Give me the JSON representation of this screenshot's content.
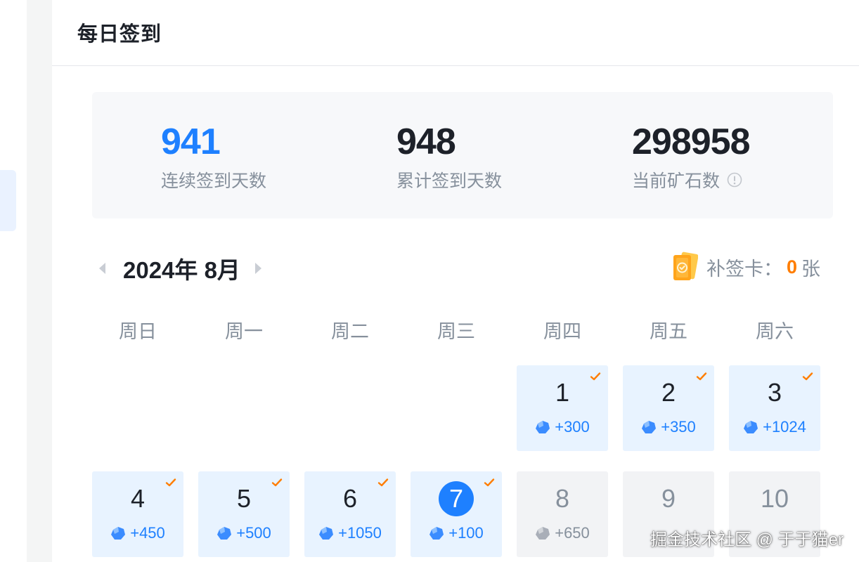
{
  "header": {
    "title": "每日签到"
  },
  "stats": [
    {
      "value": "941",
      "label": "连续签到天数",
      "color": "#1e80ff",
      "info": false
    },
    {
      "value": "948",
      "label": "累计签到天数",
      "color": "#1d2129",
      "info": false
    },
    {
      "value": "298958",
      "label": "当前矿石数",
      "color": "#1d2129",
      "info": true
    }
  ],
  "calendar": {
    "month_label": "2024年 8月",
    "makeup_card": {
      "label": "补签卡：",
      "count": "0",
      "unit": "张"
    },
    "weekdays": [
      "周日",
      "周一",
      "周二",
      "周三",
      "周四",
      "周五",
      "周六"
    ],
    "days": [
      {
        "day": "1",
        "reward": "+300",
        "status": "signed",
        "checked": true
      },
      {
        "day": "2",
        "reward": "+350",
        "status": "signed",
        "checked": true
      },
      {
        "day": "3",
        "reward": "+1024",
        "status": "signed",
        "checked": true
      },
      {
        "day": "4",
        "reward": "+450",
        "status": "signed",
        "checked": true
      },
      {
        "day": "5",
        "reward": "+500",
        "status": "signed",
        "checked": true
      },
      {
        "day": "6",
        "reward": "+1050",
        "status": "signed",
        "checked": true
      },
      {
        "day": "7",
        "reward": "+100",
        "status": "today",
        "checked": true
      },
      {
        "day": "8",
        "reward": "+650",
        "status": "future",
        "checked": false
      },
      {
        "day": "9",
        "reward": "",
        "status": "future",
        "checked": false
      },
      {
        "day": "10",
        "reward": "",
        "status": "future",
        "checked": false
      }
    ],
    "first_weekday_index": 4
  },
  "watermark": "掘金技术社区 @ 于于猫er",
  "colors": {
    "accent": "#1e80ff",
    "orange": "#ff7d00",
    "signed_bg": "#e8f3ff",
    "future_bg": "#f2f3f5"
  }
}
